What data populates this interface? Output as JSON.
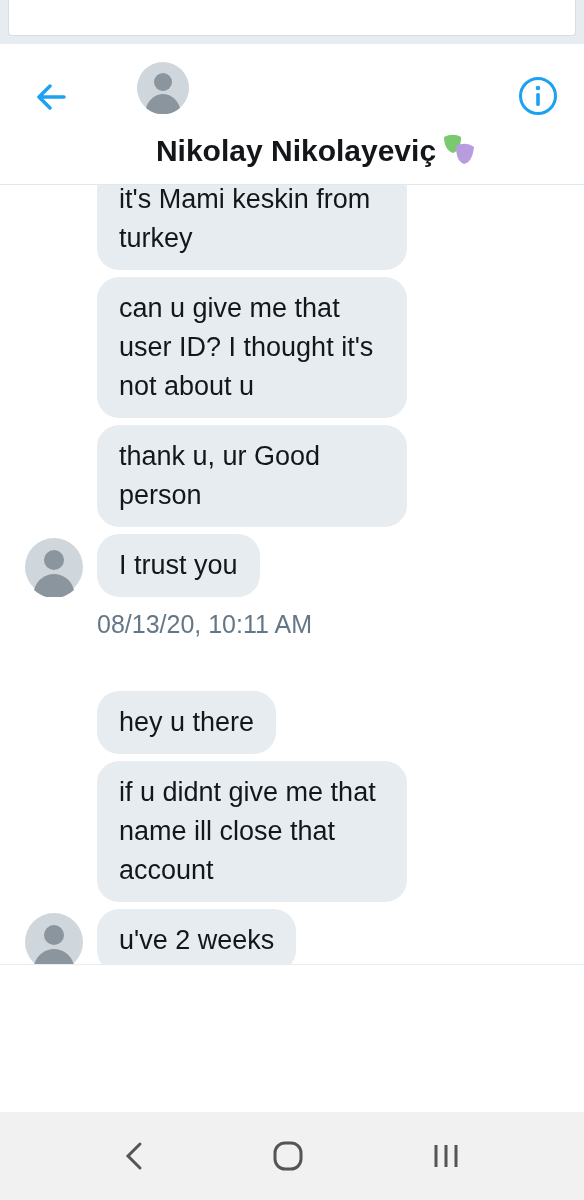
{
  "header": {
    "title": "Nikolay Nikolayeviç"
  },
  "messages": [
    {
      "kind": "message",
      "text": "it's Mami keskin from turkey",
      "avatar": false
    },
    {
      "kind": "message",
      "text": "can u give me that user ID? I thought it's not about u",
      "avatar": false
    },
    {
      "kind": "message",
      "text": "thank u, ur Good person",
      "avatar": false
    },
    {
      "kind": "message",
      "text": "I trust you",
      "avatar": true
    },
    {
      "kind": "timestamp",
      "text": "08/13/20, 10:11 AM"
    },
    {
      "kind": "message",
      "text": "hey u there",
      "avatar": false
    },
    {
      "kind": "message",
      "text": "if u didnt give me that name ill close that account",
      "avatar": false
    },
    {
      "kind": "message",
      "text": "u've 2 weeks",
      "avatar": true
    }
  ]
}
